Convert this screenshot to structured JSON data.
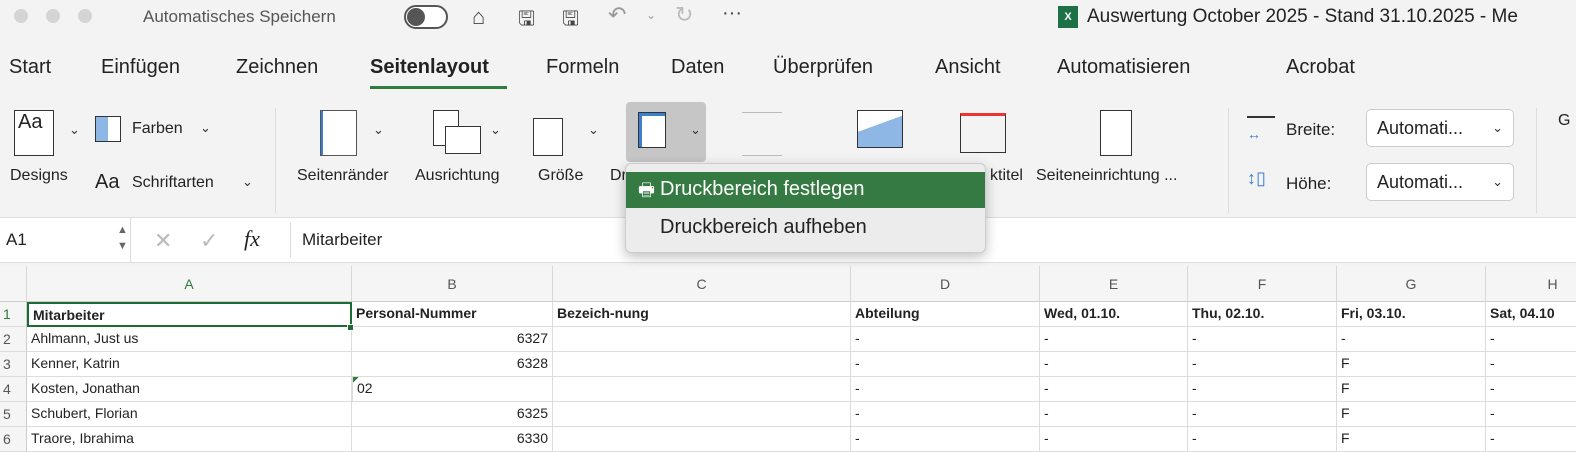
{
  "titlebar": {
    "autosave_label": "Automatisches Speichern",
    "document_title": "Auswertung October 2025 - Stand 31.10.2025 - Me"
  },
  "tabs": [
    "Start",
    "Einfügen",
    "Zeichnen",
    "Seitenlayout",
    "Formeln",
    "Daten",
    "Überprüfen",
    "Ansicht",
    "Automatisieren",
    "Acrobat"
  ],
  "active_tab": "Seitenlayout",
  "ribbon": {
    "designs": "Designs",
    "farben": "Farben",
    "schriftarten": "Schriftarten",
    "seitenraender": "Seitenränder",
    "ausrichtung": "Ausrichtung",
    "groesse": "Größe",
    "druckbereich_partial": "Dr",
    "drucktitel_partial": "ktitel",
    "seiteneinrichtung": "Seiteneinrichtung ...",
    "breite": "Breite:",
    "hoehe": "Höhe:",
    "breite_value": "Automati...",
    "hoehe_value": "Automati...",
    "cut_label": "G"
  },
  "dropdown": {
    "items": [
      "Druckbereich festlegen",
      "Druckbereich aufheben"
    ],
    "highlighted": 0
  },
  "formula_bar": {
    "name_box": "A1",
    "fx": "fx",
    "content": "Mitarbeiter"
  },
  "colors": {
    "accent": "#2e7d3e",
    "menu_highlight": "#357a42"
  },
  "sheet": {
    "columns": [
      "A",
      "B",
      "C",
      "D",
      "E",
      "F",
      "G",
      "H"
    ],
    "rows": [
      {
        "n": "1",
        "cells": [
          "Mitarbeiter",
          "Personal-Nummer",
          "Bezeich-nung",
          "Abteilung",
          "Wed, 01.10.",
          "Thu, 02.10.",
          "Fri, 03.10.",
          "Sat, 04.10"
        ]
      },
      {
        "n": "2",
        "cells": [
          "Ahlmann, Just us",
          "6327",
          "",
          "-",
          "-",
          "-",
          "-",
          "-"
        ]
      },
      {
        "n": "3",
        "cells": [
          "Kenner, Katrin",
          "6328",
          "",
          "-",
          "-",
          "-",
          "F",
          "-"
        ]
      },
      {
        "n": "4",
        "cells": [
          "Kosten, Jonathan",
          "02",
          "",
          "-",
          "-",
          "-",
          "F",
          "-"
        ]
      },
      {
        "n": "5",
        "cells": [
          "Schubert, Florian",
          "6325",
          "",
          "-",
          "-",
          "-",
          "F",
          "-"
        ]
      },
      {
        "n": "6",
        "cells": [
          "Traore, Ibrahima",
          "6330",
          "",
          "-",
          "-",
          "-",
          "F",
          "-"
        ]
      }
    ]
  }
}
